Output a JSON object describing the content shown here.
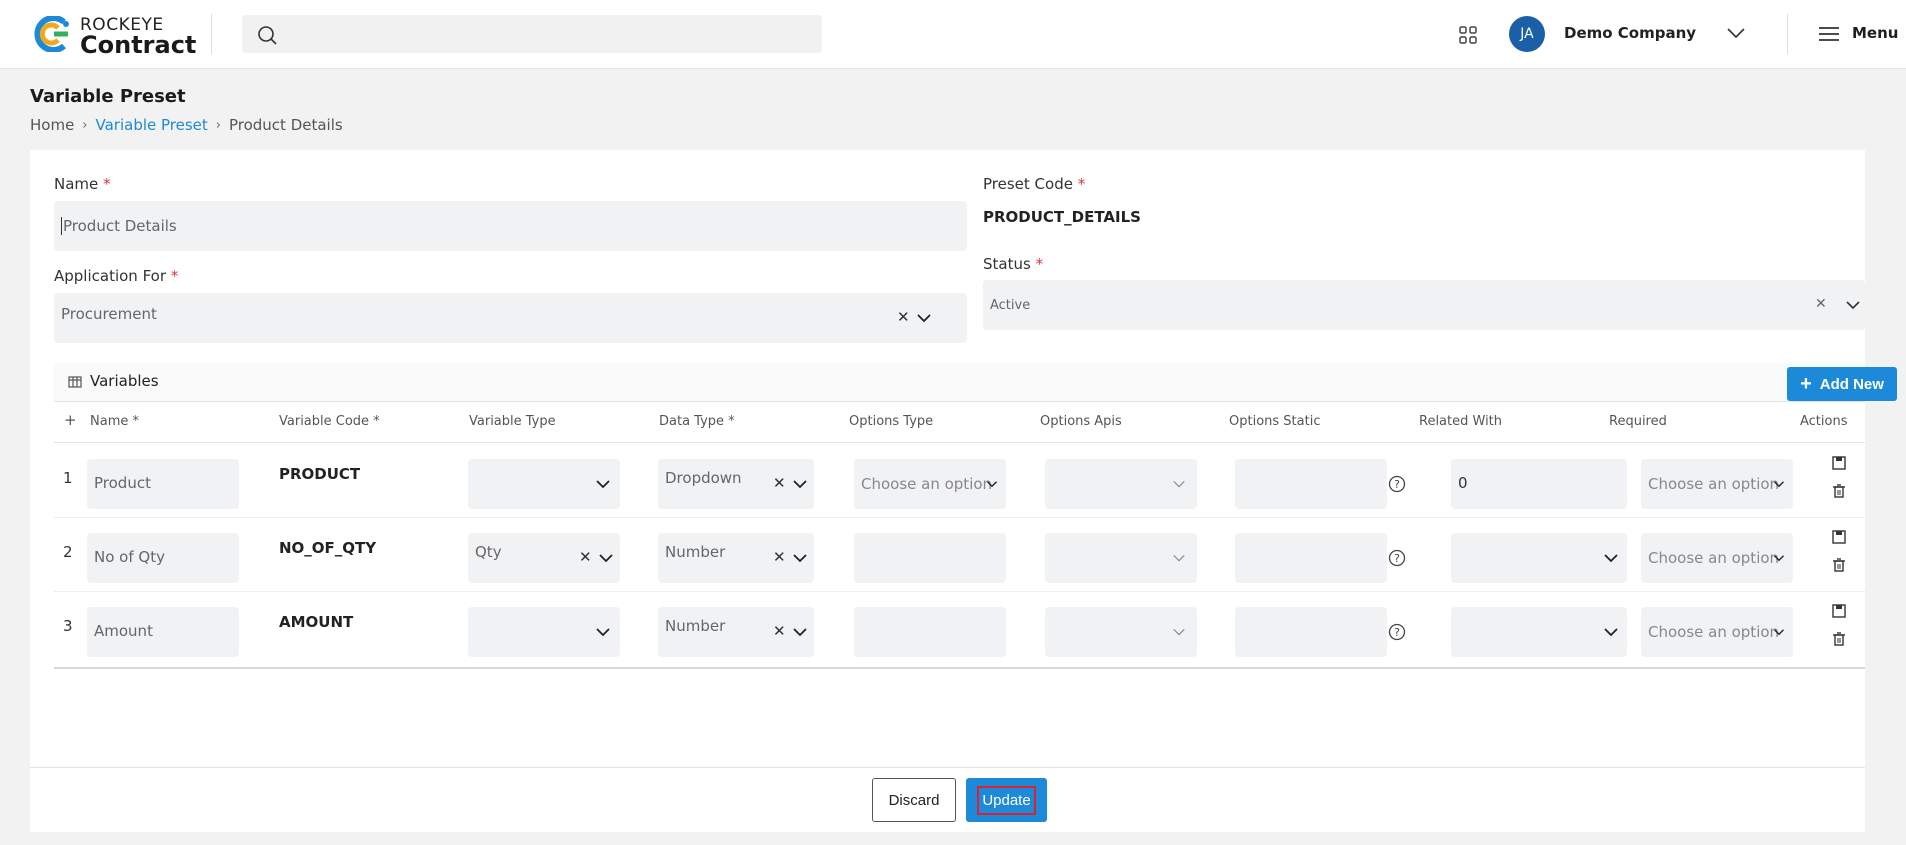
{
  "brand": {
    "top": "ROCKEYE",
    "bottom": "Contract"
  },
  "header": {
    "avatar_initials": "JA",
    "company": "Demo Company",
    "menu_label": "Menu"
  },
  "page": {
    "title": "Variable Preset"
  },
  "breadcrumb": [
    "Home",
    "Variable Preset",
    "Product Details"
  ],
  "form": {
    "name_label": "Name",
    "name_value": "Product Details",
    "preset_code_label": "Preset Code",
    "preset_code_value": "PRODUCT_DETAILS",
    "application_label": "Application For",
    "application_value": "Procurement",
    "status_label": "Status",
    "status_value": "Active",
    "required_mark": "*"
  },
  "variables": {
    "title": "Variables",
    "add_new_label": "Add New",
    "columns": [
      "+",
      "Name *",
      "Variable Code *",
      "Variable Type",
      "Data Type *",
      "Options Type",
      "Options Apis",
      "Options Static",
      "Related With",
      "Required",
      "Actions"
    ],
    "rows": [
      {
        "num": "1",
        "name": "Product",
        "code": "PRODUCT",
        "variable_type": "",
        "data_type": "Dropdown",
        "options_type": "Choose an option",
        "related_with": "0",
        "required": "Choose an option"
      },
      {
        "num": "2",
        "name": "No of Qty",
        "code": "NO_OF_QTY",
        "variable_type": "Qty",
        "data_type": "Number",
        "options_type": "",
        "related_with": "",
        "required": "Choose an option"
      },
      {
        "num": "3",
        "name": "Amount",
        "code": "AMOUNT",
        "variable_type": "",
        "data_type": "Number",
        "options_type": "",
        "related_with": "",
        "required": "Choose an option"
      }
    ]
  },
  "footer": {
    "discard_label": "Discard",
    "update_label": "Update"
  },
  "colors": {
    "accent": "#1c8ad8",
    "avatar": "#1b5fa6",
    "required": "#d9363e",
    "highlight": "#e0202b"
  },
  "icons": [
    "logo-mark",
    "search-icon",
    "apps-grid-icon",
    "chevron-down-icon",
    "hamburger-icon",
    "table-icon",
    "plus-icon",
    "help-icon",
    "save-icon",
    "delete-icon",
    "clear-icon"
  ]
}
